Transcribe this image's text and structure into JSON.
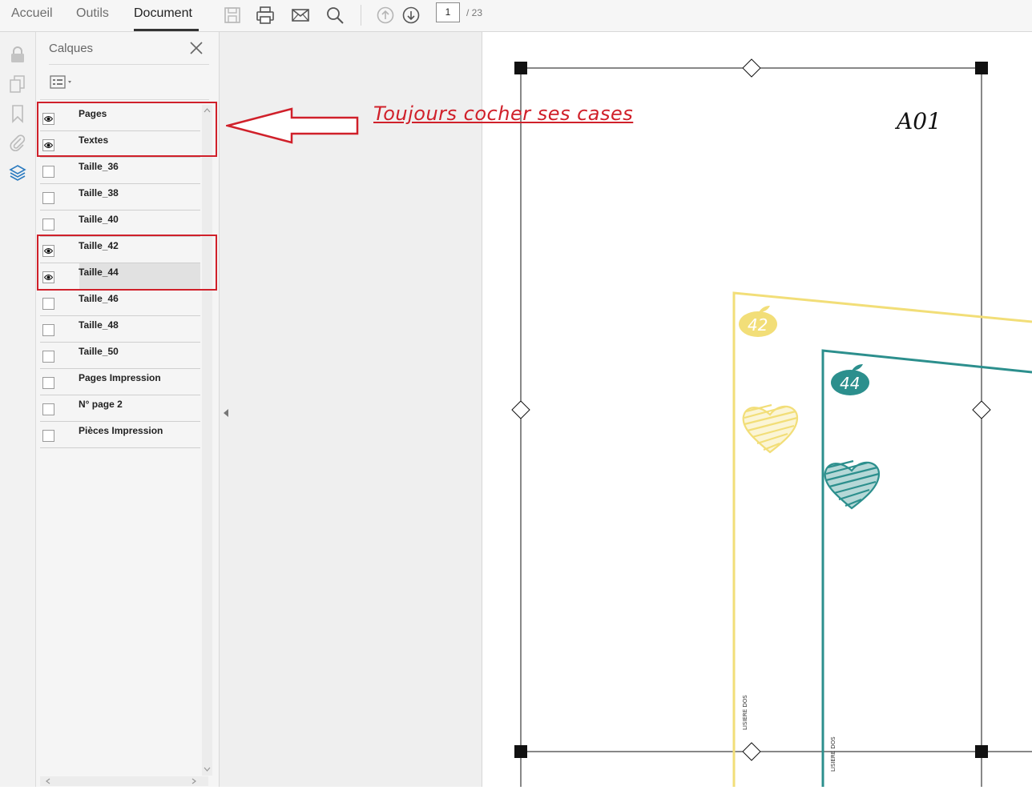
{
  "toolbar": {
    "tabs": [
      "Accueil",
      "Outils",
      "Document"
    ],
    "active_tab": "Document",
    "page_current": "1",
    "page_total": "/ 23",
    "icons": [
      "save-icon",
      "print-icon",
      "email-icon",
      "search-icon",
      "page-up-icon",
      "page-down-icon"
    ]
  },
  "rail": {
    "icons": [
      "lock-icon",
      "pages-icon",
      "bookmark-icon",
      "attachment-icon",
      "layers-icon"
    ]
  },
  "panel": {
    "title": "Calques",
    "layers": [
      {
        "name": "Pages",
        "visible": true
      },
      {
        "name": "Textes",
        "visible": true
      },
      {
        "name": "Taille_36",
        "visible": false
      },
      {
        "name": "Taille_38",
        "visible": false
      },
      {
        "name": "Taille_40",
        "visible": false
      },
      {
        "name": "Taille_42",
        "visible": true
      },
      {
        "name": "Taille_44",
        "visible": true,
        "selected": true
      },
      {
        "name": "Taille_46",
        "visible": false
      },
      {
        "name": "Taille_48",
        "visible": false
      },
      {
        "name": "Taille_50",
        "visible": false
      },
      {
        "name": "Pages Impression",
        "visible": false
      },
      {
        "name": "N° page 2",
        "visible": false
      },
      {
        "name": "Pièces Impression",
        "visible": false
      }
    ]
  },
  "annotation": {
    "text": "Toujours cocher ses cases",
    "color": "#d0202a"
  },
  "document": {
    "sheet_label": "A01",
    "size_labels": [
      "42",
      "44"
    ],
    "side_labels": [
      "LISIERE DOS",
      "LISIERE DOS"
    ],
    "colors": {
      "size_42": "#f2de78",
      "size_44": "#2c8f8d"
    }
  }
}
